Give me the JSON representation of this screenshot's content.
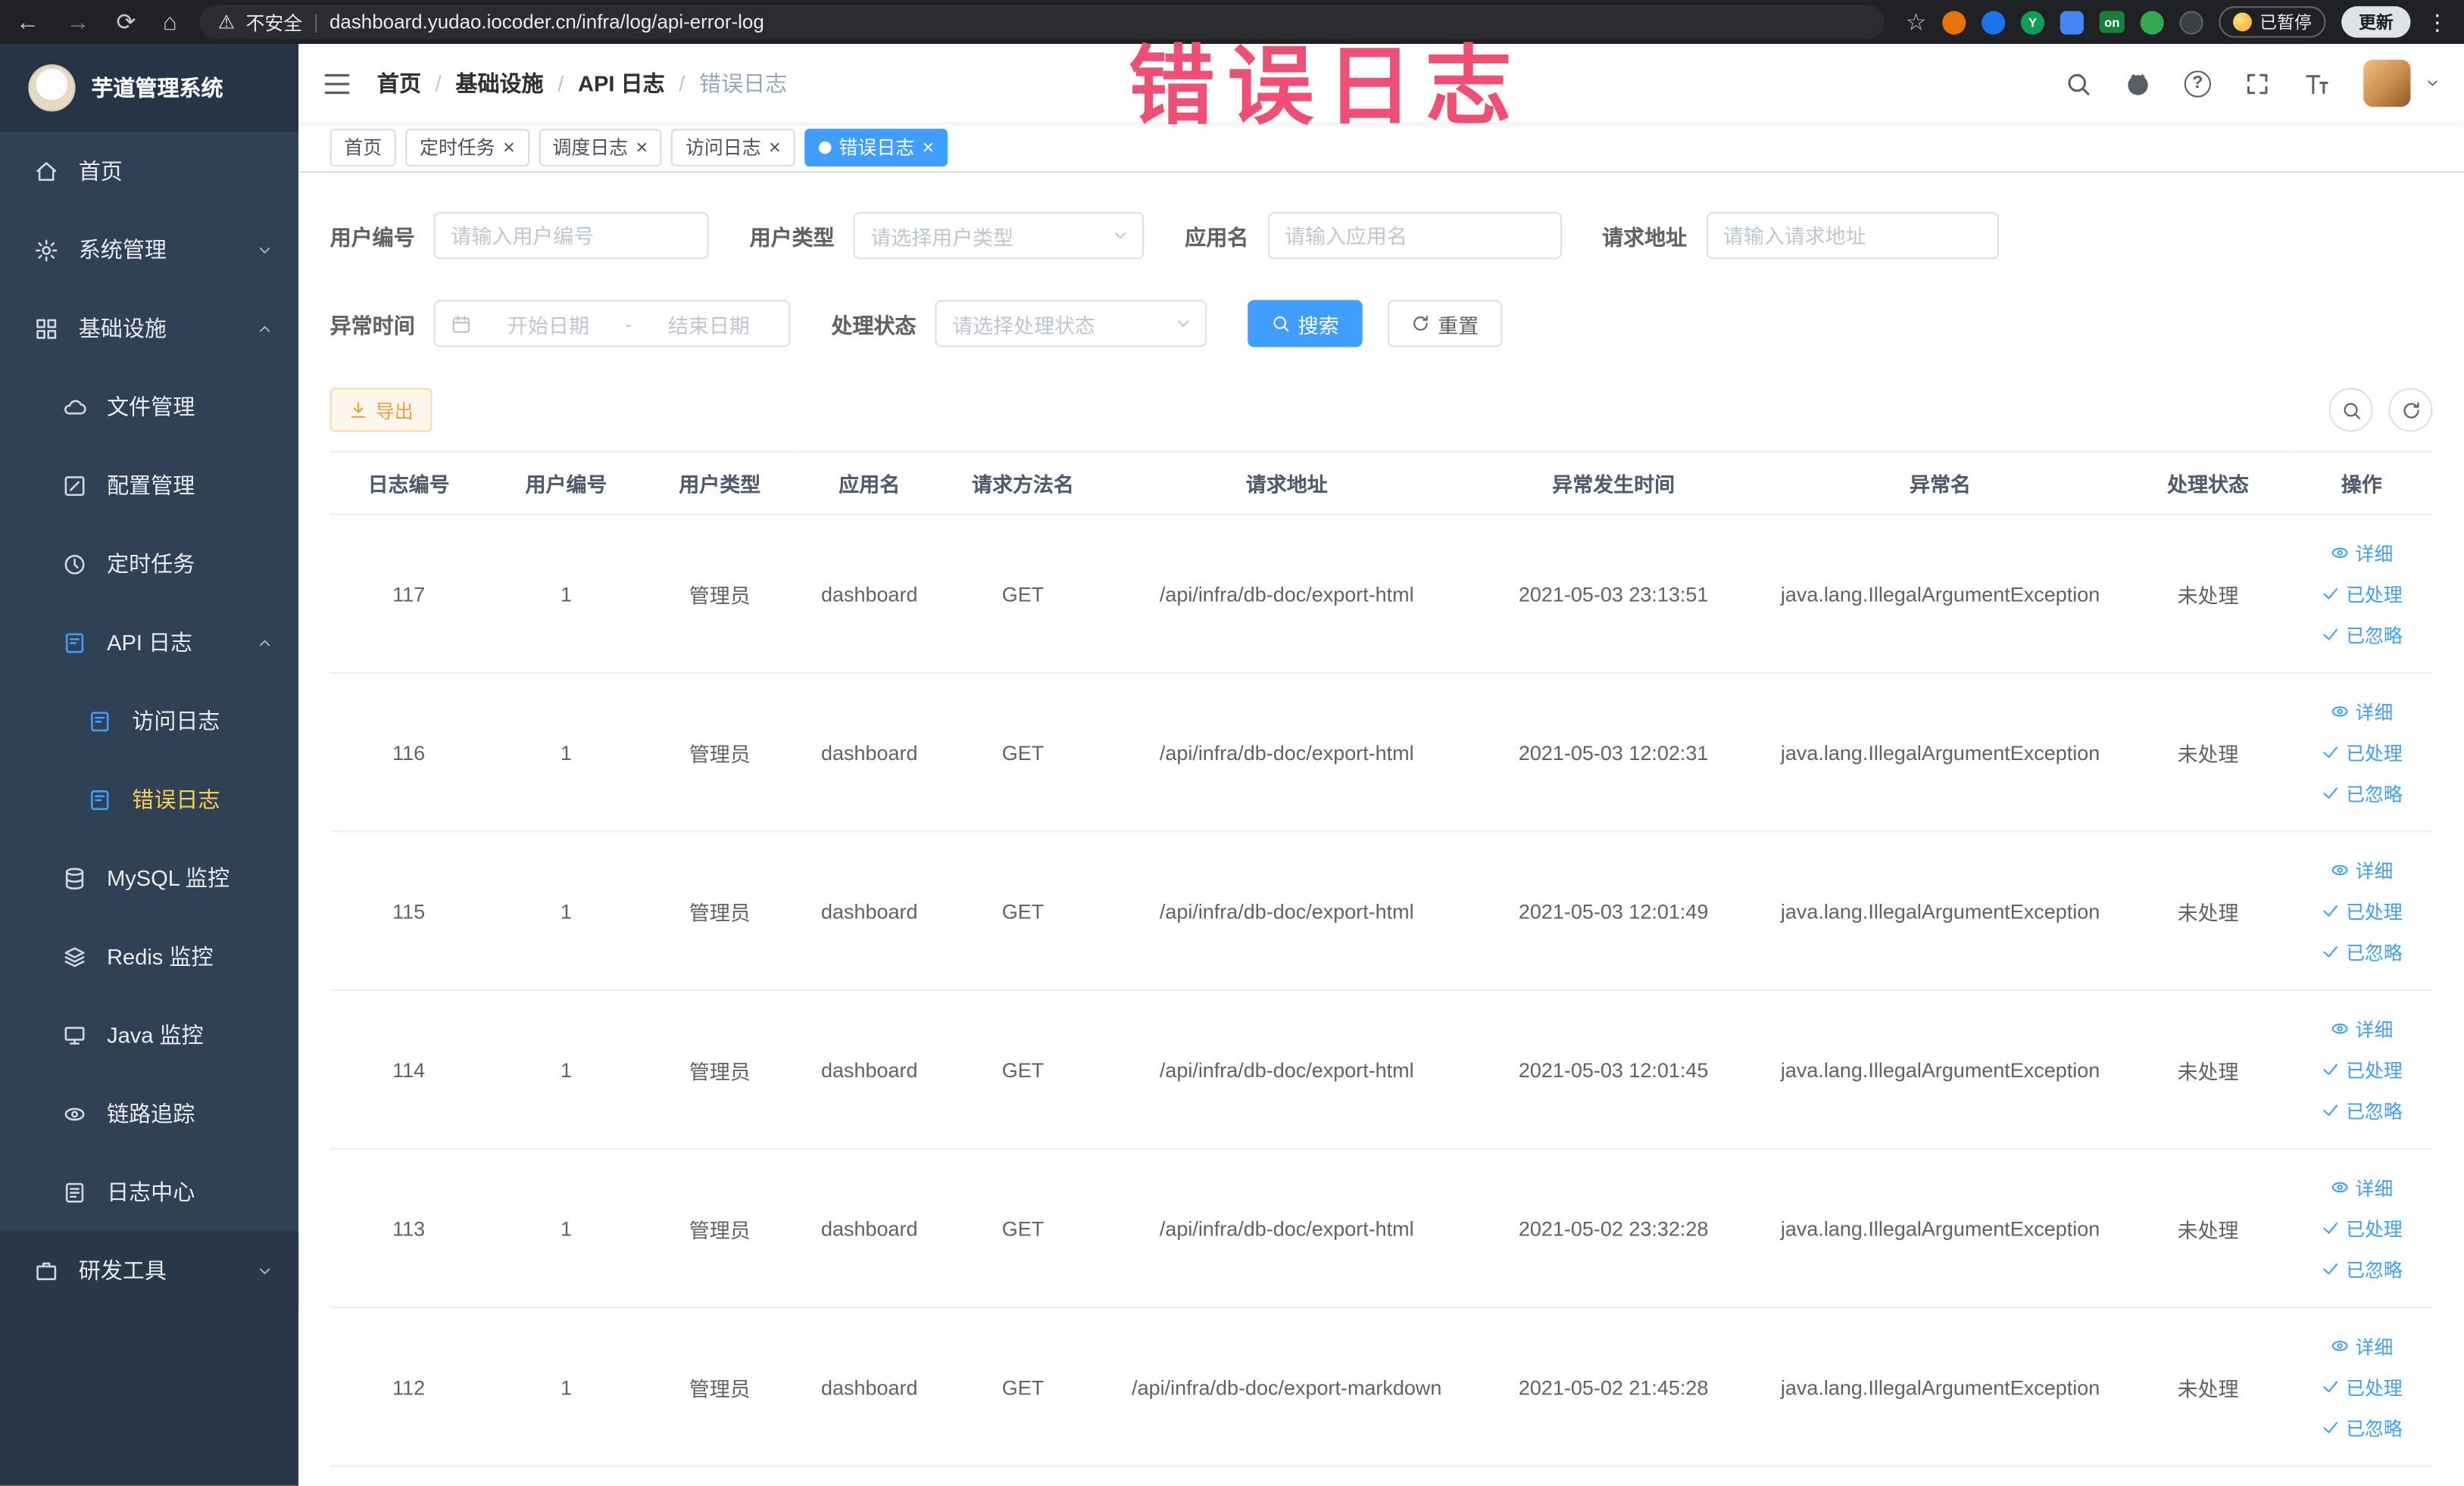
{
  "watermark": "错误日志",
  "icons": {
    "back": "←",
    "forward": "→",
    "reload": "⟳",
    "home": "⌂",
    "warning": "⚠",
    "star": "☆",
    "overflow_menu": "⋮",
    "close": "×",
    "help": "?",
    "url_separator": "|"
  },
  "browser": {
    "security_label": "不安全",
    "url": "dashboard.yudao.iocoder.cn/infra/log/api-error-log",
    "extension_on_badge": "on",
    "paused_badge": "已暂停",
    "update_button": "更新"
  },
  "sidebar": {
    "logo_title": "芋道管理系统",
    "menu": {
      "home": "首页",
      "system": "系统管理",
      "infra": "基础设施",
      "file": "文件管理",
      "config": "配置管理",
      "job": "定时任务",
      "api_log": "API 日志",
      "access_log": "访问日志",
      "error_log": "错误日志",
      "mysql": "MySQL 监控",
      "redis": "Redis 监控",
      "java": "Java 监控",
      "trace": "链路追踪",
      "log_center": "日志中心",
      "dev_tools": "研发工具"
    }
  },
  "breadcrumb": [
    "首页",
    "基础设施",
    "API 日志",
    "错误日志"
  ],
  "tabs": [
    {
      "label": "首页"
    },
    {
      "label": "定时任务"
    },
    {
      "label": "调度日志"
    },
    {
      "label": "访问日志"
    },
    {
      "label": "错误日志"
    }
  ],
  "filters": {
    "user_id": {
      "label": "用户编号",
      "placeholder": "请输入用户编号"
    },
    "user_type": {
      "label": "用户类型",
      "placeholder": "请选择用户类型"
    },
    "app_name": {
      "label": "应用名",
      "placeholder": "请输入应用名"
    },
    "request_url": {
      "label": "请求地址",
      "placeholder": "请输入请求地址"
    },
    "exception_time": {
      "label": "异常时间",
      "start_placeholder": "开始日期",
      "separator": "-",
      "end_placeholder": "结束日期"
    },
    "process_status": {
      "label": "处理状态",
      "placeholder": "请选择处理状态"
    },
    "search_button": "搜索",
    "reset_button": "重置"
  },
  "toolbar": {
    "export_button": "导出"
  },
  "table": {
    "headers": [
      "日志编号",
      "用户编号",
      "用户类型",
      "应用名",
      "请求方法名",
      "请求地址",
      "异常发生时间",
      "异常名",
      "处理状态",
      "操作"
    ],
    "actions": [
      "详细",
      "已处理",
      "已忽略"
    ],
    "rows": [
      {
        "id": "117",
        "user_id": "1",
        "user_type": "管理员",
        "app": "dashboard",
        "method": "GET",
        "url": "/api/infra/db-doc/export-html",
        "time": "2021-05-03 23:13:51",
        "exception": "java.lang.IllegalArgumentException",
        "status": "未处理"
      },
      {
        "id": "116",
        "user_id": "1",
        "user_type": "管理员",
        "app": "dashboard",
        "method": "GET",
        "url": "/api/infra/db-doc/export-html",
        "time": "2021-05-03 12:02:31",
        "exception": "java.lang.IllegalArgumentException",
        "status": "未处理"
      },
      {
        "id": "115",
        "user_id": "1",
        "user_type": "管理员",
        "app": "dashboard",
        "method": "GET",
        "url": "/api/infra/db-doc/export-html",
        "time": "2021-05-03 12:01:49",
        "exception": "java.lang.IllegalArgumentException",
        "status": "未处理"
      },
      {
        "id": "114",
        "user_id": "1",
        "user_type": "管理员",
        "app": "dashboard",
        "method": "GET",
        "url": "/api/infra/db-doc/export-html",
        "time": "2021-05-03 12:01:45",
        "exception": "java.lang.IllegalArgumentException",
        "status": "未处理"
      },
      {
        "id": "113",
        "user_id": "1",
        "user_type": "管理员",
        "app": "dashboard",
        "method": "GET",
        "url": "/api/infra/db-doc/export-html",
        "time": "2021-05-02 23:32:28",
        "exception": "java.lang.IllegalArgumentException",
        "status": "未处理"
      },
      {
        "id": "112",
        "user_id": "1",
        "user_type": "管理员",
        "app": "dashboard",
        "method": "GET",
        "url": "/api/infra/db-doc/export-markdown",
        "time": "2021-05-02 21:45:28",
        "exception": "java.lang.IllegalArgumentException",
        "status": "未处理"
      }
    ]
  },
  "colors": {
    "primary": "#409EFF",
    "warning_button": "#E6A23C",
    "sidebar_bg": "#304156",
    "active_menu_text": "#FFD04B",
    "active_tab_bg": "#409EFF",
    "watermark_pink": "#EF4F74",
    "chrome_bg": "#202124"
  }
}
